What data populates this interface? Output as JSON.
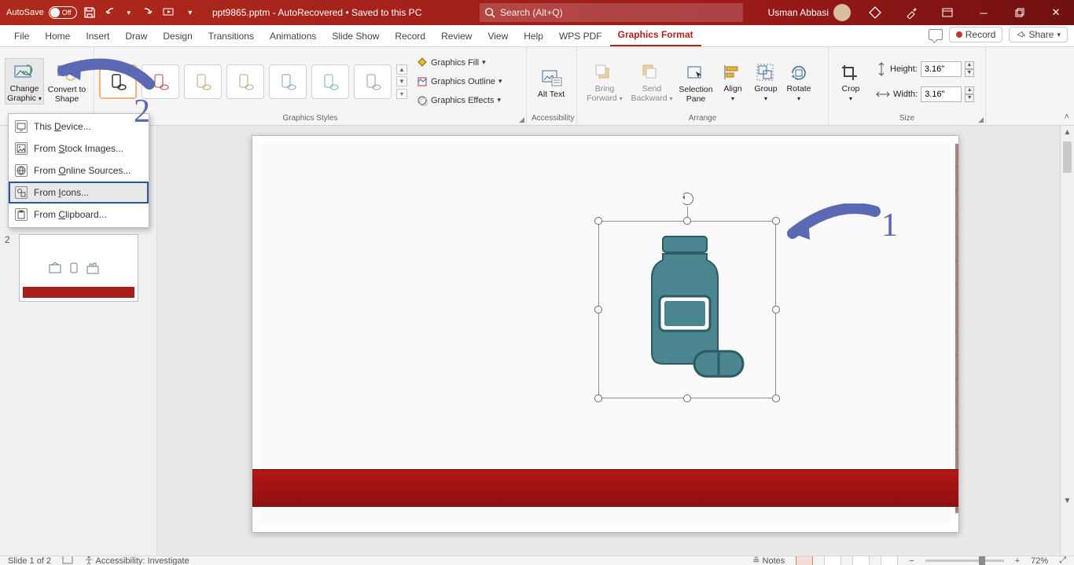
{
  "titlebar": {
    "autosave_label": "AutoSave",
    "autosave_state": "Off",
    "doc_title": "ppt9865.pptm  -  AutoRecovered  •  Saved to this PC",
    "search_placeholder": "Search (Alt+Q)",
    "user_name": "Usman Abbasi"
  },
  "tabs": {
    "items": [
      "File",
      "Home",
      "Insert",
      "Draw",
      "Design",
      "Transitions",
      "Animations",
      "Slide Show",
      "Record",
      "Review",
      "View",
      "Help",
      "WPS PDF",
      "Graphics Format"
    ],
    "active": "Graphics Format",
    "record_btn": "Record",
    "share_btn": "Share"
  },
  "ribbon": {
    "change_graphic": "Change Graphic",
    "convert_shape": "Convert to Shape",
    "graphics_fill": "Graphics Fill",
    "graphics_outline": "Graphics Outline",
    "graphics_effects": "Graphics Effects",
    "alt_text": "Alt Text",
    "bring_forward": "Bring Forward",
    "send_backward": "Send Backward",
    "selection_pane": "Selection Pane",
    "align": "Align",
    "group": "Group",
    "rotate": "Rotate",
    "crop": "Crop",
    "height_label": "Height:",
    "height_value": "3.16\"",
    "width_label": "Width:",
    "width_value": "3.16\"",
    "grp_styles": "Graphics Styles",
    "grp_access": "Accessibility",
    "grp_arrange": "Arrange",
    "grp_size": "Size"
  },
  "dropdown": {
    "this_device": "This Device...",
    "stock_images": "From Stock Images...",
    "online_sources": "From Online Sources...",
    "from_icons": "From Icons...",
    "from_clipboard": "From Clipboard..."
  },
  "thumbs": {
    "slide2_num": "2"
  },
  "status": {
    "slide_info": "Slide 1 of 2",
    "accessibility": "Accessibility: Investigate",
    "notes": "Notes",
    "zoom": "72%"
  },
  "annotations": {
    "one": "1",
    "two": "2"
  }
}
